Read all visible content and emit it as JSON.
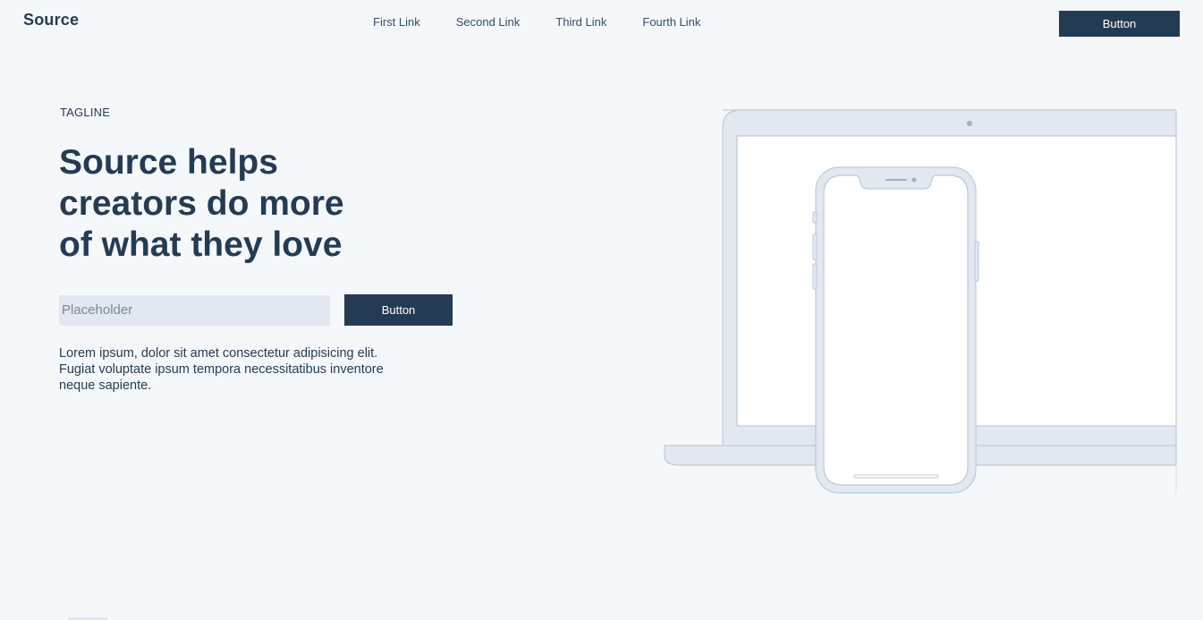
{
  "header": {
    "brand": "Source",
    "nav": [
      "First Link",
      "Second Link",
      "Third Link",
      "Fourth Link"
    ],
    "button_label": "Button"
  },
  "hero": {
    "tagline": "TAGLINE",
    "headline": "Source helps creators do more of what they love",
    "input_placeholder": "Placeholder",
    "button_label": "Button",
    "body": "Lorem ipsum, dolor sit amet consectetur adipisicing elit. Fugiat voluptate ipsum tempora necessitatibus inventore neque sapiente."
  },
  "illustration": {
    "devices": [
      "laptop-icon",
      "smartphone-icon"
    ],
    "colors": {
      "frame_fill": "#e1e8f0",
      "frame_stroke": "#bccad6",
      "screen": "#ffffff"
    }
  },
  "colors": {
    "background": "#f5f8fb",
    "primary": "#243b53",
    "field": "#e1e8f0"
  }
}
